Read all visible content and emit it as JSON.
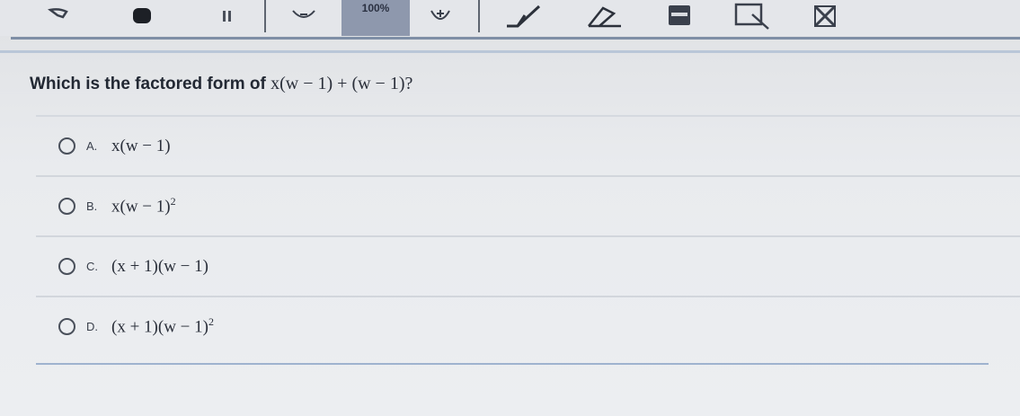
{
  "toolbar": {
    "zoom_label": "100%",
    "icons": [
      "pointer-icon",
      "hand-icon",
      "pause-icon",
      "zoom-out-icon",
      "zoom-in-icon",
      "pencil-icon",
      "eraser-icon",
      "highlighter-icon",
      "reference-icon",
      "eliminate-icon"
    ]
  },
  "question": {
    "text": "Which is the factored form of ",
    "expression": "x(w − 1) + (w − 1)?"
  },
  "choices": [
    {
      "letter": "A.",
      "answer": "x(w − 1)",
      "sup": ""
    },
    {
      "letter": "B.",
      "answer": "x(w − 1)",
      "sup": "2"
    },
    {
      "letter": "C.",
      "answer": "(x + 1)(w − 1)",
      "sup": ""
    },
    {
      "letter": "D.",
      "answer": "(x + 1)(w − 1)",
      "sup": "2"
    }
  ],
  "colors": {
    "zoom_bg": "#8e98ad",
    "toolbar_rule": "#7f8fa6",
    "accent_rule": "#9fb3cf"
  }
}
